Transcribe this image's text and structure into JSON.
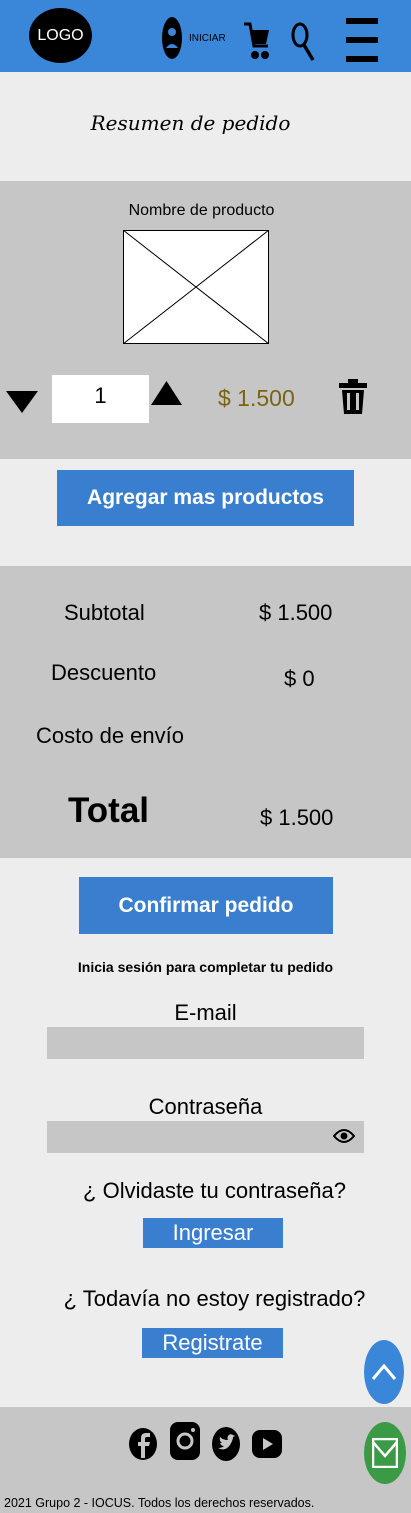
{
  "header": {
    "logo_text": "LOGO",
    "login_label": "INICIAR",
    "icons": [
      "user-icon",
      "cart-icon",
      "search-icon",
      "menu-icon"
    ],
    "color": "#3a86d8"
  },
  "page": {
    "title": "Resumen de pedido"
  },
  "cart_item": {
    "name": "Nombre de producto",
    "quantity": "1",
    "price": "$ 1.500"
  },
  "add_more_label": "Agregar mas productos",
  "summary": {
    "rows": [
      {
        "label": "Subtotal",
        "value": "$ 1.500"
      },
      {
        "label": "Descuento",
        "value": "$ 0"
      },
      {
        "label": "Costo de envío",
        "value": ""
      }
    ],
    "total_label": "Total",
    "total_value": "$ 1.500"
  },
  "confirm_label": "Confirmar pedido",
  "login": {
    "hint": "Inicia sesión para completar tu pedido",
    "email_label": "E-mail",
    "email_value": "",
    "password_label": "Contraseña",
    "password_value": "",
    "forgot_label": "¿ Olvidaste tu contraseña?",
    "submit_label": "Ingresar",
    "not_registered_label": "¿ Todavía no estoy registrado?",
    "register_label": "Registrate"
  },
  "footer": {
    "social_icons": [
      "facebook-icon",
      "instagram-icon",
      "twitter-icon",
      "youtube-icon"
    ],
    "copyright": "2021 Grupo 2 - IOCUS. Todos los derechos reservados."
  },
  "colors": {
    "accent": "#3a7fcf",
    "panel": "#c6c6c6",
    "price": "#7a6410",
    "mail": "#3a9a45"
  }
}
